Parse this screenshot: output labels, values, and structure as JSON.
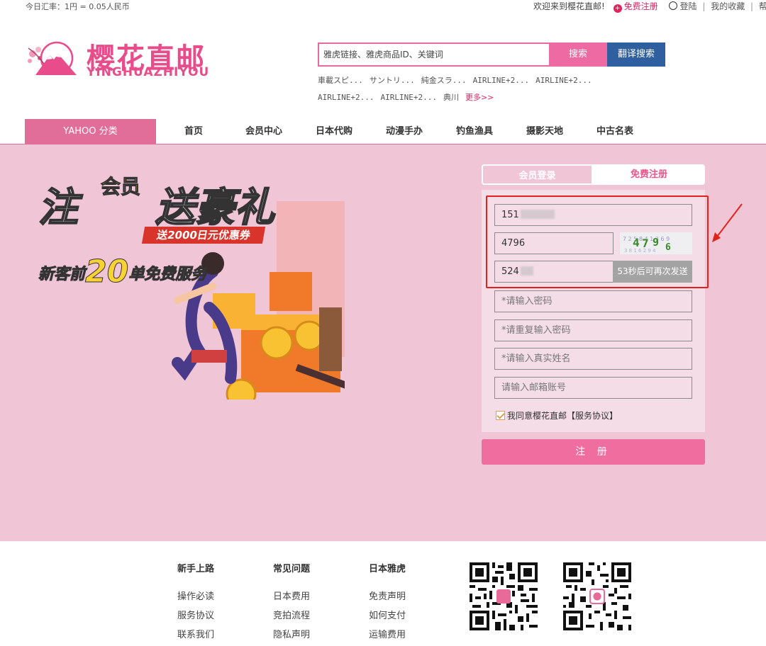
{
  "topbar": {
    "rate": "今日汇率：1円 = 0.05人民币",
    "welcome": "欢迎来到樱花直邮!",
    "register": "免费注册",
    "login": "登陆",
    "favorites": "我的收藏",
    "help": "帮助"
  },
  "logo": {
    "cn": "樱花直邮",
    "en": "YINGHUAZHIYOU"
  },
  "search": {
    "placeholder": "雅虎链接、雅虎商品ID、关键词",
    "search_label": "搜索",
    "translate_label": "翻译搜索",
    "hot": [
      "車載スピ...",
      "サントリ...",
      "純金スラ...",
      "AIRLINE+2...",
      "AIRLINE+2...",
      "AIRLINE+2...",
      "AIRLINE+2...",
      "典川"
    ],
    "more": "更多>>"
  },
  "nav": {
    "category": "YAHOO 分类",
    "items": [
      "首页",
      "会员中心",
      "日本代购",
      "动漫手办",
      "钓鱼渔具",
      "摄影天地",
      "中古名表"
    ]
  },
  "promo": {
    "line1a": "注",
    "line1_vip": "会员",
    "line1b": "送豪礼",
    "coupon": "送2000日元优惠券",
    "line2_pre": "新客前",
    "line2_num": "20",
    "line2_post": "单免费服务"
  },
  "tabs": {
    "login": "会员登录",
    "register": "免费注册"
  },
  "form": {
    "phone_prefix": "151",
    "captcha_input": "4796",
    "captcha_text": "4796",
    "sms_prefix": "524",
    "send_again": "53秒后可再次发送",
    "password_ph": "*请输入密码",
    "password2_ph": "*请重复输入密码",
    "realname_ph": "*请输入真实姓名",
    "email_ph": "请输入邮箱账号",
    "agree": "我同意樱花直邮【服务协议】",
    "submit": "注 册"
  },
  "colors": {
    "brand_pink": "#e84c8b",
    "banner_bg": "#f0c5d5",
    "nav_blue": "#2f5f9e",
    "highlight_red": "#e2231a"
  },
  "footer": {
    "cols": [
      {
        "title": "新手上路",
        "links": [
          "操作必读",
          "服务协议",
          "联系我们"
        ]
      },
      {
        "title": "常见问题",
        "links": [
          "日本费用",
          "竞拍流程",
          "隐私声明"
        ]
      },
      {
        "title": "日本雅虎",
        "links": [
          "免责声明",
          "如何支付",
          "运输费用"
        ]
      }
    ]
  }
}
